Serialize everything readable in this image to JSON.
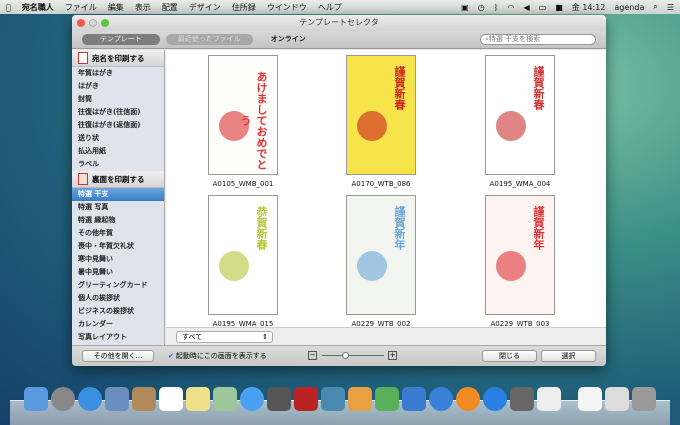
{
  "menubar": {
    "app": "宛名職人",
    "items": [
      "ファイル",
      "編集",
      "表示",
      "配置",
      "デザイン",
      "住所録",
      "ウインドウ",
      "ヘルプ"
    ],
    "clock": "金 14:12",
    "user": "agenda"
  },
  "window": {
    "title": "テンプレートセレクタ"
  },
  "toolbar": {
    "tabs": [
      "テンプレート",
      "最近使ったファイル",
      "オンライン"
    ],
    "search_placeholder": "特選 干支を検索"
  },
  "sidebar": {
    "section1": "宛名を印刷する",
    "items1": [
      "年賀はがき",
      "はがき",
      "封筒",
      "往復はがき(往信面)",
      "往復はがき(返信面)",
      "送り状",
      "払込用紙",
      "ラベル"
    ],
    "section2": "裏面を印刷する",
    "items2": [
      "特選 干支",
      "特選 写真",
      "特選 縁起物",
      "その他年賀",
      "喪中・年賀欠礼状",
      "寒中見舞い",
      "暑中見舞い",
      "グリーティングカード",
      "個人の挨拶状",
      "ビジネスの挨拶状",
      "カレンダー",
      "写真レイアウト"
    ],
    "selected": "特選 干支"
  },
  "templates": [
    {
      "name": "A0105_WMB_001",
      "text": "あけましておめでとう",
      "bg": "#fdfdfb",
      "accent": "#d33"
    },
    {
      "name": "A0170_WTB_086",
      "text": "謹賀新春",
      "bg": "#f7e34a",
      "accent": "#c22"
    },
    {
      "name": "A0195_WMA_004",
      "text": "謹賀新春",
      "bg": "#ffffff",
      "accent": "#c33"
    },
    {
      "name": "A0195_WMA_015",
      "text": "恭賀新春",
      "bg": "#ffffff",
      "accent": "#b8c43a"
    },
    {
      "name": "A0229_WTB_002",
      "text": "謹賀新年",
      "bg": "#f2f4f0",
      "accent": "#6aa6d8"
    },
    {
      "name": "A0229_WTB_003",
      "text": "謹賀新年",
      "bg": "#fdf3f1",
      "accent": "#d33"
    }
  ],
  "filter": {
    "value": "すべて"
  },
  "bottom": {
    "open_other": "その他を開く...",
    "show_on_launch": "起動時にこの画面を表示する",
    "show_on_launch_checked": true,
    "zoom_level": 0.35,
    "close": "閉じる",
    "select": "選択"
  }
}
